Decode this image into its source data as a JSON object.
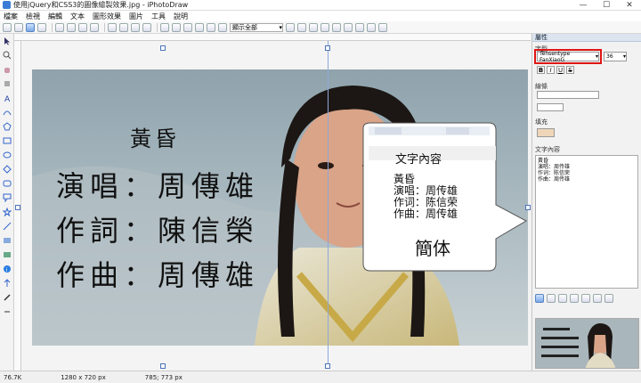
{
  "window": {
    "title": "使用jQuery和CSS3的圖像繪製效果.jpg - iPhotoDraw",
    "minimize": "—",
    "maximize": "☐",
    "close": "✕"
  },
  "menu": [
    "檔案",
    "檢視",
    "編輯",
    "文本",
    "圖形效果",
    "圖片",
    "工具",
    "說明"
  ],
  "toolbar": {
    "zoom_label": "顯示全部"
  },
  "photo_text": {
    "line1": "黃昏",
    "line2": "演唱：周傳雄",
    "line3": "作詞：陳信榮",
    "line4": "作曲：周傳雄"
  },
  "callout": {
    "header": "文字內容",
    "content_lines": [
      "黃昏",
      "演唱：周传雄",
      "作词：陈信荣",
      "作曲：周传雄"
    ],
    "caption": "簡体"
  },
  "panel": {
    "title": "屬性",
    "font_section": "字型",
    "font_name": "Tensentype FanXiaoG",
    "font_size": "36",
    "line_section": "線條",
    "fill_section": "填充",
    "text_section": "文字內容",
    "text_value": "黃昏\n演唱：周传雄\n作词：陈信荣\n作曲：周传雄",
    "format_buttons": [
      "B",
      "I",
      "U",
      "S"
    ]
  },
  "status": {
    "filesize": "76.7K",
    "dimensions": "1280 x 720 px",
    "cursor": "785; 773 px"
  },
  "colors": {
    "highlight": "#e01515",
    "accent": "#4a73b8"
  }
}
